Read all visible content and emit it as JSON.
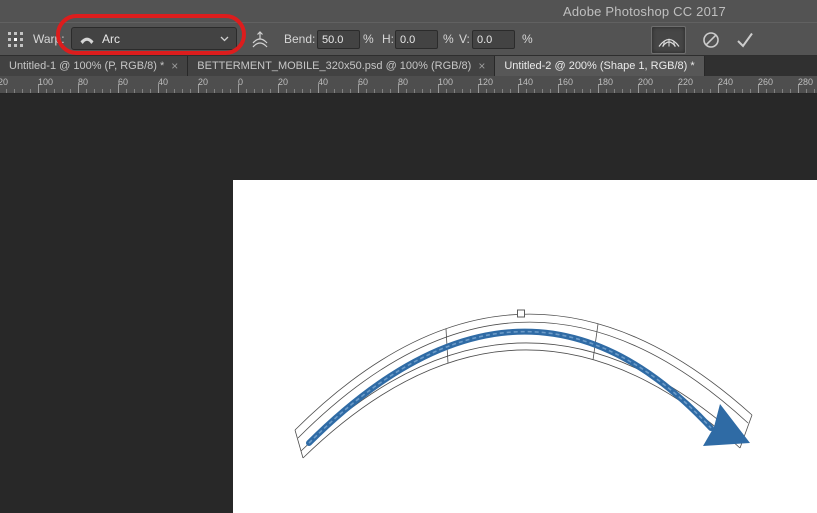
{
  "title_bar": {
    "app_title": "Adobe Photoshop CC 2017"
  },
  "options_bar": {
    "warp_label": "Warp:",
    "warp_value": "Arc",
    "bend_label": "Bend:",
    "bend_value": "50.0",
    "h_label": "H:",
    "h_value": "0.0",
    "v_label": "V:",
    "v_value": "0.0",
    "unit": "%",
    "icons": {
      "reference_point": "grid-3x3",
      "warp_style": "arc-glyph",
      "chevron": "chevron-down",
      "orientation": "warp-orientation",
      "warp_mode": "warp-grid-fan",
      "cancel": "circle-slash",
      "commit": "checkmark"
    }
  },
  "tabs": [
    {
      "label": "Untitled-1 @ 100% (P, RGB/8) *",
      "close": "×",
      "active": false
    },
    {
      "label": "BETTERMENT_MOBILE_320x50.psd @ 100% (RGB/8)",
      "close": "×",
      "active": false
    },
    {
      "label": "Untitled-2 @ 200% (Shape 1, RGB/8) *",
      "active": true
    }
  ],
  "ruler": {
    "labels": [
      "20",
      "100",
      "80",
      "60",
      "40",
      "20",
      "0",
      "20",
      "40",
      "60",
      "80",
      "100",
      "120",
      "140",
      "160",
      "180",
      "200",
      "220",
      "240",
      "260",
      "280"
    ],
    "spacing_px": 40
  },
  "canvas": {
    "content": "blue arc-warped arrow with warp mesh and top center handle"
  },
  "colors": {
    "annotation_red": "#dc1d1d",
    "arrow_blue": "#2f6ba5",
    "bar_gray": "#535353",
    "pasteboard": "#282828"
  }
}
